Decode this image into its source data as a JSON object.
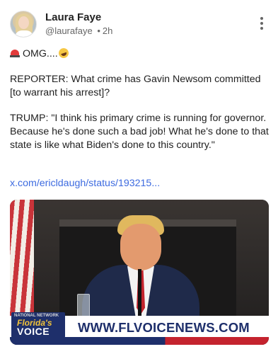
{
  "author": {
    "name": "Laura Faye",
    "handle": "@laurafaye",
    "separator": "•",
    "time": "2h"
  },
  "post": {
    "line1_text": "OMG....",
    "line1_icons": [
      "police-siren-icon",
      "laughing-emoji-icon"
    ],
    "paragraph_reporter": "REPORTER: What crime has Gavin Newsom committed [to warrant his arrest]?",
    "paragraph_trump": "TRUMP: \"I think his primary crime is running for governor. Because he's done such a bad job! What he's done to that state is like what Biden's done to this country.\"",
    "link_text": "x.com/ericldaugh/status/193215..."
  },
  "media": {
    "logo_tag": "NATIONAL NETWORK",
    "logo_line1": "Florida's",
    "logo_line2": "VOICE",
    "banner_url": "WWW.FLVOICENEWS.COM"
  },
  "colors": {
    "link": "#3d6be0",
    "banner_navy": "#1e2f6b",
    "banner_red": "#c4232e"
  }
}
